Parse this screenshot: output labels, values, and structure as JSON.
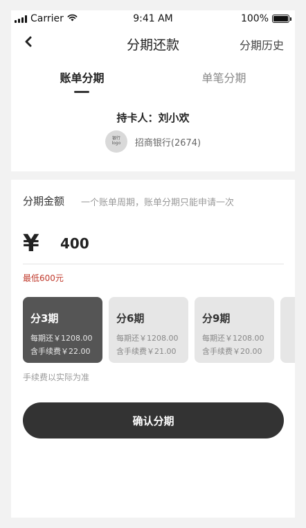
{
  "status_bar": {
    "carrier": "Carrier",
    "time": "9:41 AM",
    "battery": "100%"
  },
  "nav": {
    "title": "分期还款",
    "history": "分期历史",
    "back_icon": "chevron-left-icon"
  },
  "tabs": [
    {
      "label": "账单分期",
      "active": true
    },
    {
      "label": "单笔分期",
      "active": false
    }
  ],
  "card_holder": {
    "text": "持卡人：刘小欢"
  },
  "bank": {
    "logo_line1": "银行",
    "logo_line2": "logo",
    "name": "招商银行(2674)"
  },
  "amount": {
    "label": "分期金额",
    "hint": "一个账单周期，账单分期只能申请一次",
    "currency": "¥",
    "value": "400",
    "min_note": "最低600元"
  },
  "plans": [
    {
      "title": "分3期",
      "per_period": "每期还￥1208.00",
      "fee": "含手续费￥22.00",
      "selected": true
    },
    {
      "title": "分6期",
      "per_period": "每期还￥1208.00",
      "fee": "含手续费￥21.00",
      "selected": false
    },
    {
      "title": "分9期",
      "per_period": "每期还￥1208.00",
      "fee": "含手续费￥20.00",
      "selected": false
    }
  ],
  "fee_note": "手续费以实际为准",
  "confirm_button": "确认分期",
  "colors": {
    "primary": "#333333",
    "selected_card": "#555555",
    "unselected_card": "#e6e6e6",
    "warning": "#c0392b",
    "page_bg": "#f2f2f2"
  }
}
